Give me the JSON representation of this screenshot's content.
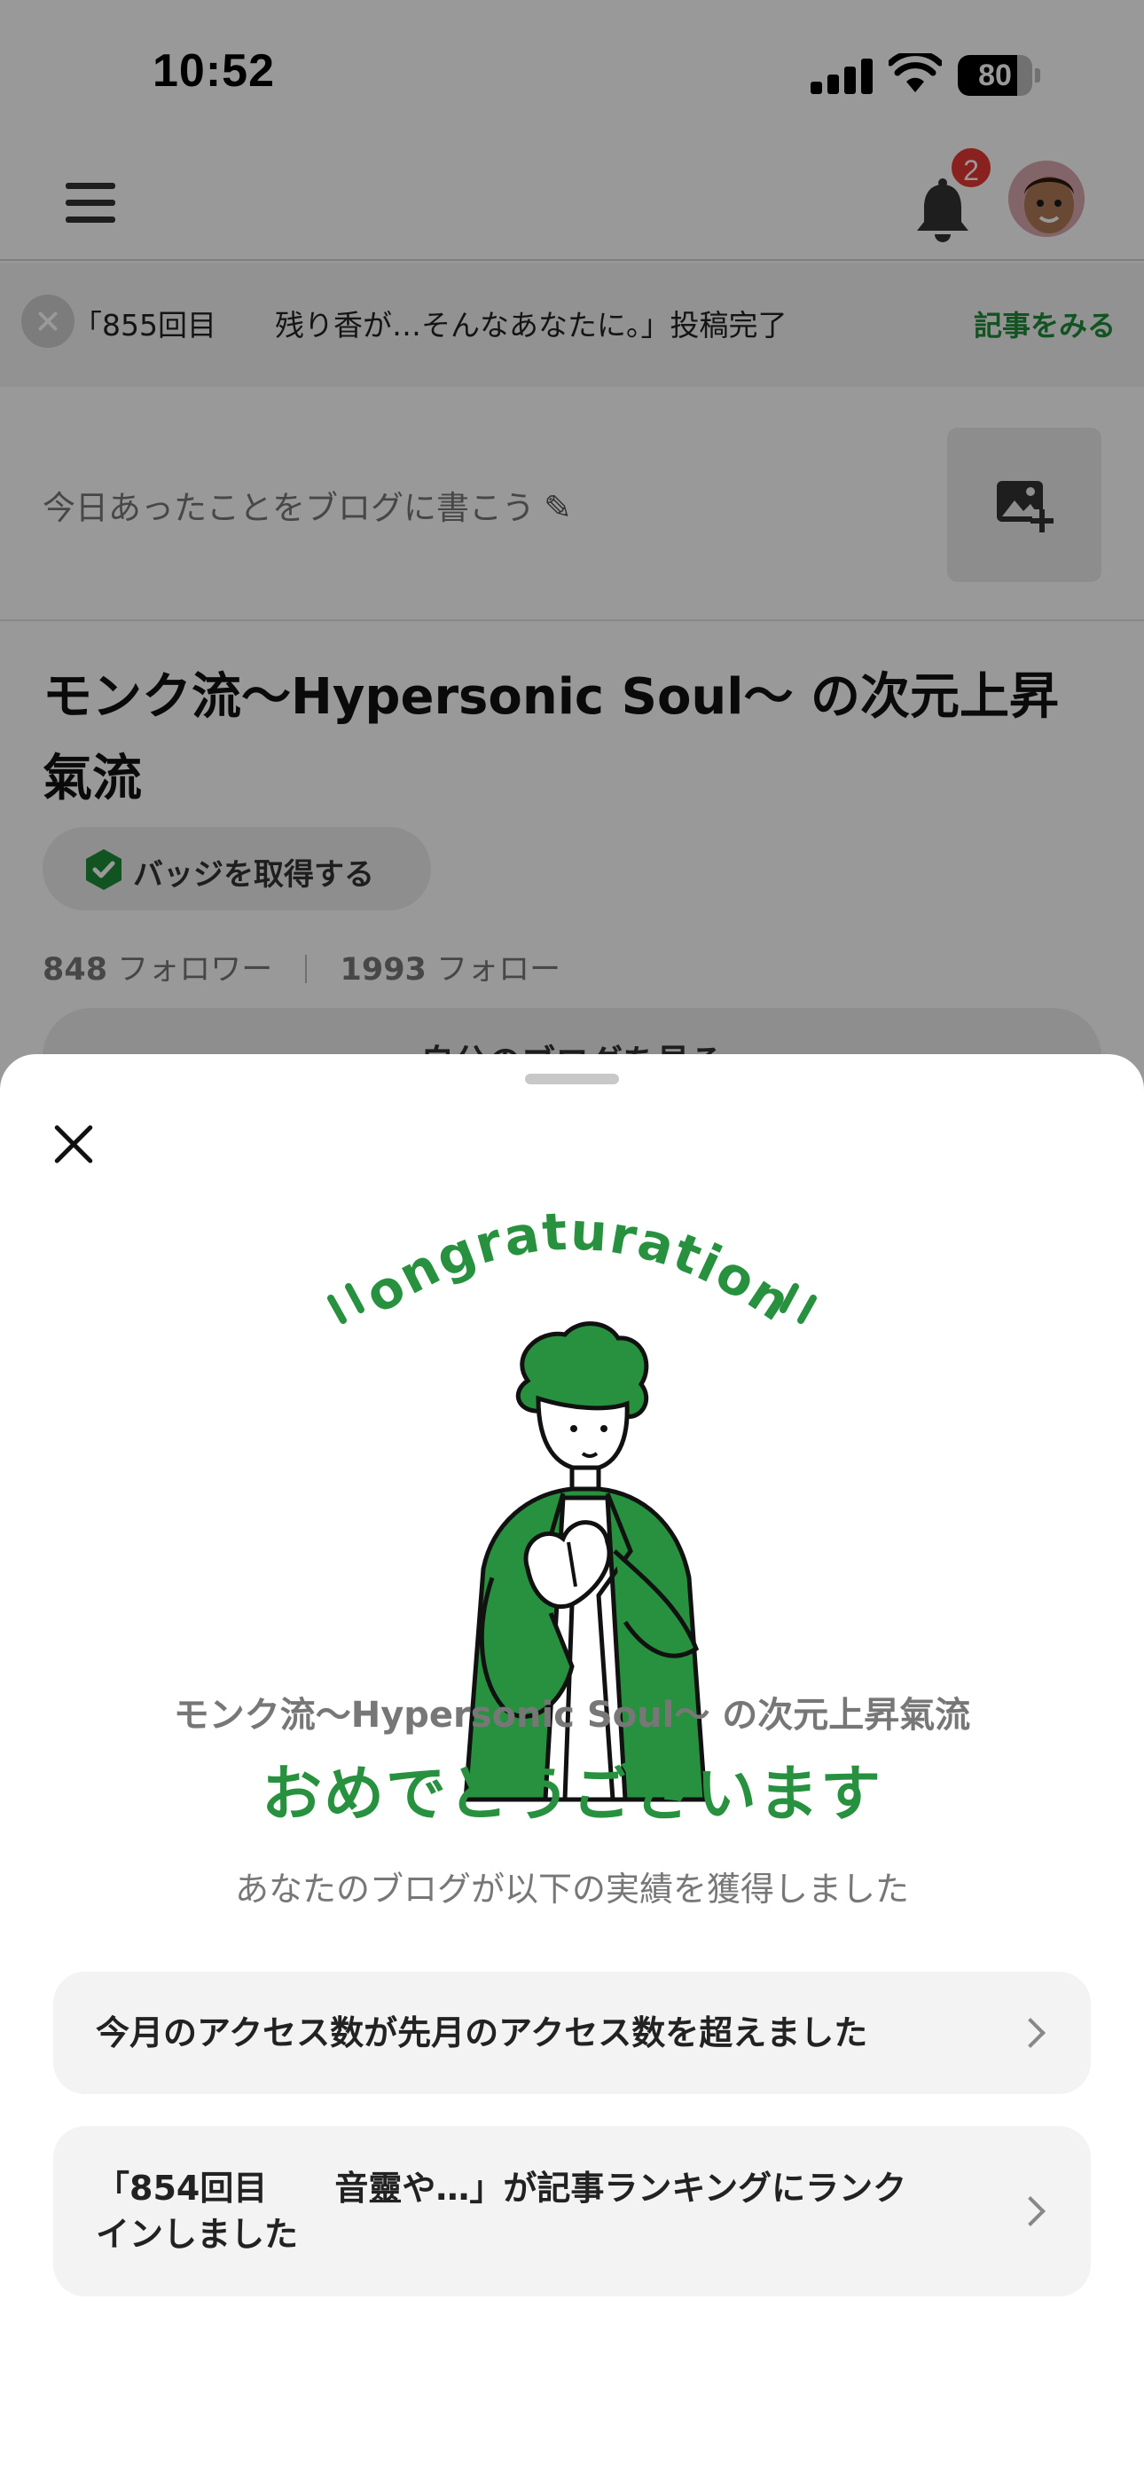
{
  "status_bar": {
    "time": "10:52",
    "battery": "80",
    "battery_level": 0.8
  },
  "header": {
    "menu_icon": "hamburger-menu-icon",
    "bell_icon": "bell-icon",
    "notification_count": "2",
    "avatar": "user-avatar"
  },
  "notice": {
    "text": "「855回目　　残り香が…そんなあなたに。」投稿完了",
    "link": "記事をみる"
  },
  "compose": {
    "placeholder": "今日あったことをブログに書こう",
    "image_icon": "image-add-icon"
  },
  "blog": {
    "title": "モンク流〜Hypersonic Soul〜 の次元上昇氣流",
    "badge_label": "バッジを取得する",
    "followers_count": "848",
    "followers_label": "フォロワー",
    "following_count": "1993",
    "following_label": "フォロー",
    "view_blog_label": "自分のブログを見る"
  },
  "sheet": {
    "illustration_text": "Congraturation!",
    "blog_name": "モンク流〜Hypersonic Soul〜 の次元上昇氣流",
    "heading": "おめでとうございます",
    "subtitle": "あなたのブログが以下の実績を獲得しました",
    "achievements": [
      {
        "text": "今月のアクセス数が先月のアクセス数を超えました"
      },
      {
        "text": "「854回目　　音靈や…」が記事ランキングにランク\nインしました"
      }
    ]
  },
  "colors": {
    "accent_green": "#27913f",
    "link_green": "#1f8a3a",
    "badge_red": "#e53935"
  }
}
